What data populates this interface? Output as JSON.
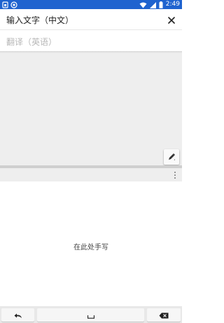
{
  "status_bar": {
    "time": "2:49",
    "left_icons": [
      "sim-icon",
      "signal-app-icon"
    ],
    "right_icons": [
      "wifi-icon",
      "cellular-icon",
      "battery-icon"
    ],
    "color": "#1f63cf"
  },
  "input": {
    "text": "输入文字（中文）",
    "close_icon": "close-icon"
  },
  "translation": {
    "placeholder": "翻译（英语）"
  },
  "canvas": {
    "pen_icon": "pen-icon"
  },
  "keyboard": {
    "more_icon": "more-vert-icon",
    "hint": "在此处手写",
    "keys": {
      "undo_icon": "undo-icon",
      "space_icon": "space-icon",
      "delete_icon": "backspace-icon"
    }
  }
}
